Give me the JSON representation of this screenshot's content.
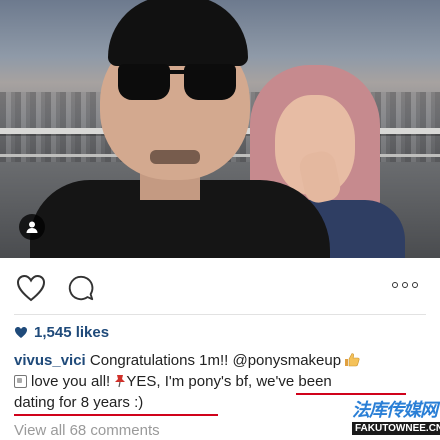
{
  "post": {
    "likes": "1,545 likes",
    "caption": {
      "username": "vivus_vici",
      "text1": "Congratulations 1m!! @ponysmakeup",
      "text2": "love you all!",
      "text3": "YES, I'm pony's bf, we've been",
      "text4": "dating for 8 years :)"
    },
    "view_comments": "View all 68 comments"
  },
  "watermark": {
    "title": "法库传媒网",
    "url": "FAKUTOWNEE.CN"
  },
  "colors": {
    "username": "#1f4a7a",
    "annotation": "#d0021b",
    "muted": "#9a9a9a"
  }
}
